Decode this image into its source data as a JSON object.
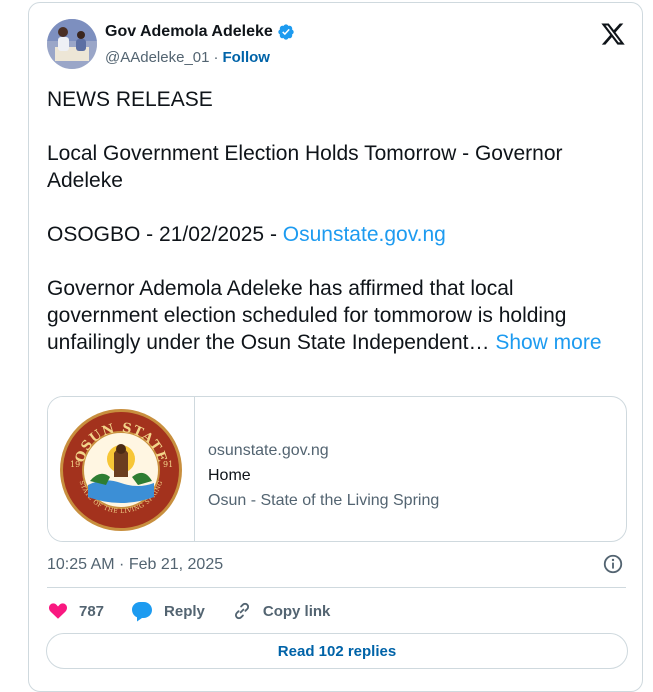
{
  "author": {
    "name": "Gov Ademola Adeleke",
    "handle": "@AAdeleke_01",
    "separator": "·",
    "follow_label": "Follow",
    "verified": true
  },
  "post": {
    "lines": [
      "NEWS RELEASE",
      "Local Government Election Holds Tomorrow - Governor Adeleke",
      "OSOGBO - 21/02/2025 - ",
      "Governor Ademola Adeleke has affirmed that local government election scheduled for tommorow is holding unfailingly under the Osun State Independent… "
    ],
    "inline_link": "Osunstate.gov.ng",
    "show_more": "Show more"
  },
  "link_preview": {
    "domain": "osunstate.gov.ng",
    "title": "Home",
    "description": "Osun - State of the Living Spring",
    "seal": {
      "top_text": "OSUN STATE",
      "bottom_text": "STATE OF THE LIVING SPRING",
      "year_left": "19",
      "year_right": "91"
    }
  },
  "timestamp": "10:25 AM · Feb 21, 2025",
  "actions": {
    "like_count": "787",
    "reply_label": "Reply",
    "copy_link_label": "Copy link"
  },
  "read_replies_label": "Read 102 replies",
  "colors": {
    "link": "#1d9bf0",
    "follow": "#0063a8",
    "like": "#f91880",
    "reply_icon": "#1d9bf0",
    "muted": "#536471",
    "border": "#cfd9de"
  },
  "icons": [
    "verified-badge-icon",
    "x-logo-icon",
    "info-icon",
    "heart-icon",
    "reply-bubble-icon",
    "link-icon"
  ]
}
